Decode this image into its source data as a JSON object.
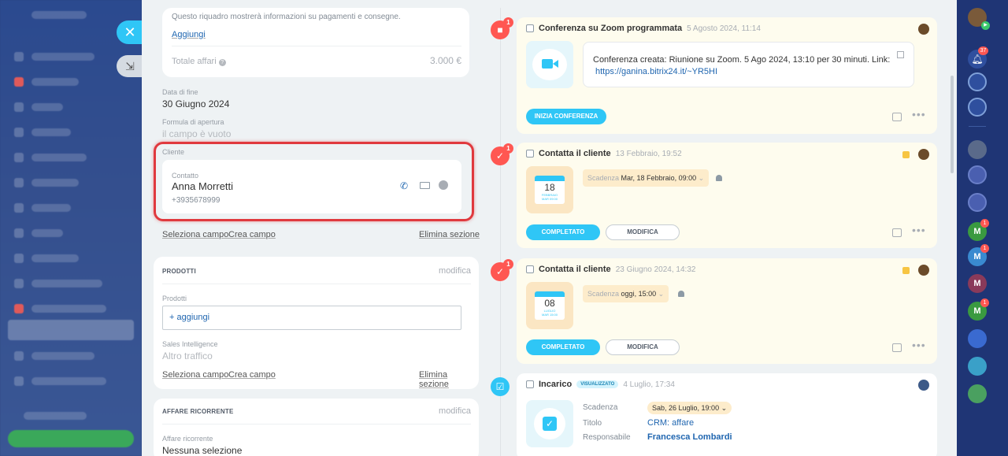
{
  "left_panel": {
    "info_text": "Questo riquadro mostrerà informazioni su pagamenti e consegne.",
    "add_link": "Aggiungi",
    "total_label": "Totale affari",
    "total_value": "3.000 €",
    "end_date_label": "Data di fine",
    "end_date_value": "30 Giugno 2024",
    "formula_label": "Formula di apertura",
    "formula_value": "il campo è vuoto",
    "client_label": "Cliente",
    "contact_label": "Contatto",
    "contact_name": "Anna Morretti",
    "contact_phone": "+3935678999",
    "select_field": "Seleziona campo",
    "create_field": "Crea campo",
    "delete_section": "Elimina sezione",
    "products_header": "PRODOTTI",
    "edit": "modifica",
    "products_label": "Prodotti",
    "add_product": "+ aggiungi",
    "sales_label": "Sales Intelligence",
    "sales_value": "Altro traffico",
    "recurring_header": "AFFARE RICORRENTE",
    "recurring_label": "Affare ricorrente",
    "recurring_value": "Nessuna selezione"
  },
  "activities": [
    {
      "title": "Conferenza su Zoom programmata",
      "date": "5 Agosto 2024, 11:14",
      "description": "Conferenza creata: Riunione su Zoom. 5 Ago 2024, 13:10 per 30 minuti. Link:",
      "link": "https://ganina.bitrix24.it/~YR5HI",
      "button": "INIZIA CONFERENZA",
      "badge": "1"
    },
    {
      "title": "Contatta il cliente",
      "date": "13 Febbraio, 19:52",
      "deadline_label": "Scadenza",
      "deadline_value": "Mar, 18 Febbraio, 09:00",
      "cal_day": "18",
      "cal_month": "FEBBRAIO",
      "cal_time": "MAR 09:00",
      "complete": "COMPLETATO",
      "modify": "MODIFICA",
      "badge": "1"
    },
    {
      "title": "Contatta il cliente",
      "date": "23 Giugno 2024, 14:32",
      "deadline_label": "Scadenza",
      "deadline_value": "oggi, 15:00",
      "cal_day": "08",
      "cal_month": "LUGLIO",
      "cal_time": "MAR 15:00",
      "complete": "COMPLETATO",
      "modify": "MODIFICA",
      "badge": "1"
    },
    {
      "title": "Incarico",
      "status": "VISUALIZZATO",
      "date": "4 Luglio, 17:34",
      "deadline_label": "Scadenza",
      "deadline_value": "Sab, 26 Luglio, 19:00",
      "title_label": "Titolo",
      "title_value": "CRM: affare",
      "resp_label": "Responsabile",
      "resp_value": "Francesca Lombardi"
    }
  ],
  "right_bar": {
    "notif_badge": "37",
    "chat_badges": [
      "1",
      "1",
      "1"
    ],
    "chat_letter": "M"
  },
  "colors": {
    "accent": "#2fc6f6",
    "alert": "#ff5752",
    "highlight": "#e0393e",
    "activity_bg": "#fefcee"
  }
}
